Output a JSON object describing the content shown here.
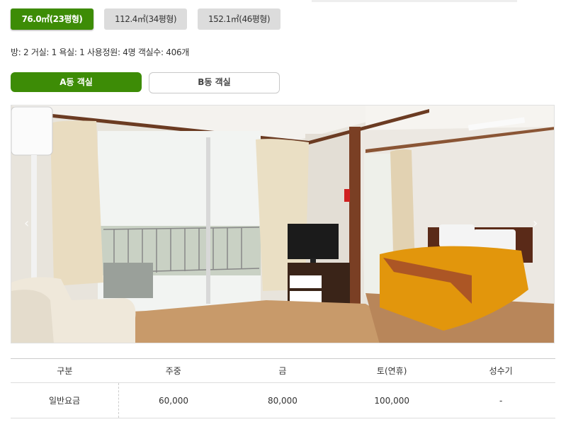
{
  "size_tabs": [
    {
      "label": "76.0㎡(23평형)",
      "active": true
    },
    {
      "label": "112.4㎡(34평형)",
      "active": false
    },
    {
      "label": "152.1㎡(46평형)",
      "active": false
    }
  ],
  "room_info": "방: 2  거실: 1  욕실: 1  사용정원: 4명  객실수: 406개",
  "building_tabs": [
    {
      "label": "A동 객실",
      "active": true
    },
    {
      "label": "B동 객실",
      "active": false
    }
  ],
  "carousel": {
    "prev_icon": "chevron-left-icon",
    "next_icon": "chevron-right-icon"
  },
  "rate_table": {
    "headers": [
      "구분",
      "주중",
      "금",
      "토(연휴)",
      "성수기"
    ],
    "rows": [
      {
        "label": "일반요금",
        "values": [
          "60,000",
          "80,000",
          "100,000",
          "-"
        ]
      }
    ]
  },
  "colors": {
    "accent": "#3d8c06",
    "inactive_tab": "#dcdcdc"
  }
}
